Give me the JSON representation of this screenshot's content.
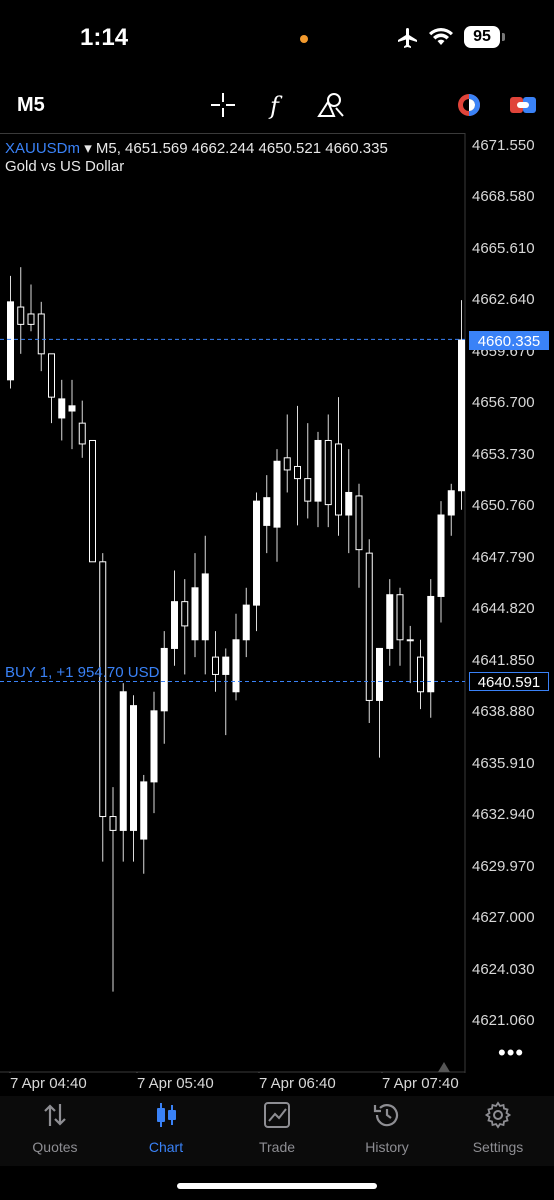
{
  "status": {
    "time": "1:14",
    "battery": "95"
  },
  "toolbar": {
    "timeframe": "M5"
  },
  "chart": {
    "symbol": "XAUUSDm",
    "header": "▾ M5, 4651.569 4662.244 4650.521 4660.335",
    "description": "Gold vs US Dollar",
    "current_price_tag": "4660.335",
    "buy_price_tag": "4640.591",
    "buy_line_label": "BUY 1, +1 954.70 USD",
    "price_labels": [
      "4671.550",
      "4668.580",
      "4665.610",
      "4662.640",
      "4659.670",
      "4656.700",
      "4653.730",
      "4650.760",
      "4647.790",
      "4644.820",
      "4641.850",
      "4638.880",
      "4635.910",
      "4632.940",
      "4629.970",
      "4627.000",
      "4624.030",
      "4621.060"
    ],
    "time_labels": [
      "7 Apr 04:40",
      "7 Apr 05:40",
      "7 Apr 06:40",
      "7 Apr 07:40"
    ],
    "more_label": "•••"
  },
  "chart_data": {
    "type": "candlestick",
    "symbol": "XAUUSDm",
    "timeframe": "M5",
    "ylim": [
      4619.6,
      4673.0
    ],
    "candles": [
      {
        "o": 4658.0,
        "h": 4664.0,
        "l": 4657.5,
        "c": 4662.5
      },
      {
        "o": 4662.2,
        "h": 4664.5,
        "l": 4659.5,
        "c": 4661.2
      },
      {
        "o": 4661.8,
        "h": 4663.5,
        "l": 4660.8,
        "c": 4661.2
      },
      {
        "o": 4661.8,
        "h": 4662.5,
        "l": 4658.5,
        "c": 4659.5
      },
      {
        "o": 4659.5,
        "h": 4659.5,
        "l": 4655.5,
        "c": 4657.0
      },
      {
        "o": 4655.8,
        "h": 4658.0,
        "l": 4654.5,
        "c": 4656.9
      },
      {
        "o": 4656.2,
        "h": 4658.0,
        "l": 4654.0,
        "c": 4656.5
      },
      {
        "o": 4655.5,
        "h": 4656.8,
        "l": 4653.5,
        "c": 4654.3
      },
      {
        "o": 4654.5,
        "h": 4654.5,
        "l": 4648.0,
        "c": 4647.5
      },
      {
        "o": 4647.5,
        "h": 4648.0,
        "l": 4630.2,
        "c": 4632.8
      },
      {
        "o": 4632.8,
        "h": 4634.5,
        "l": 4622.7,
        "c": 4632.0
      },
      {
        "o": 4632.0,
        "h": 4640.5,
        "l": 4630.2,
        "c": 4640.0
      },
      {
        "o": 4632.0,
        "h": 4639.8,
        "l": 4630.2,
        "c": 4639.2
      },
      {
        "o": 4631.5,
        "h": 4635.2,
        "l": 4629.5,
        "c": 4634.8
      },
      {
        "o": 4634.8,
        "h": 4640.0,
        "l": 4633.0,
        "c": 4638.9
      },
      {
        "o": 4638.9,
        "h": 4643.5,
        "l": 4637.0,
        "c": 4642.5
      },
      {
        "o": 4642.5,
        "h": 4647.0,
        "l": 4641.5,
        "c": 4645.2
      },
      {
        "o": 4645.2,
        "h": 4646.5,
        "l": 4641.0,
        "c": 4643.8
      },
      {
        "o": 4643.0,
        "h": 4648.0,
        "l": 4642.0,
        "c": 4646.0
      },
      {
        "o": 4643.0,
        "h": 4649.0,
        "l": 4641.0,
        "c": 4646.8
      },
      {
        "o": 4642.0,
        "h": 4643.5,
        "l": 4640.0,
        "c": 4641.0
      },
      {
        "o": 4641.0,
        "h": 4642.5,
        "l": 4637.5,
        "c": 4642.0
      },
      {
        "o": 4640.0,
        "h": 4644.5,
        "l": 4639.5,
        "c": 4643.0
      },
      {
        "o": 4643.0,
        "h": 4646.0,
        "l": 4642.0,
        "c": 4645.0
      },
      {
        "o": 4645.0,
        "h": 4651.5,
        "l": 4643.5,
        "c": 4651.0
      },
      {
        "o": 4649.6,
        "h": 4652.5,
        "l": 4648.0,
        "c": 4651.2
      },
      {
        "o": 4649.5,
        "h": 4654.0,
        "l": 4647.5,
        "c": 4653.3
      },
      {
        "o": 4653.5,
        "h": 4656.0,
        "l": 4651.5,
        "c": 4652.8
      },
      {
        "o": 4653.0,
        "h": 4656.5,
        "l": 4649.6,
        "c": 4652.3
      },
      {
        "o": 4652.3,
        "h": 4655.5,
        "l": 4650.0,
        "c": 4651.0
      },
      {
        "o": 4651.0,
        "h": 4655.0,
        "l": 4649.5,
        "c": 4654.5
      },
      {
        "o": 4654.5,
        "h": 4656.0,
        "l": 4649.5,
        "c": 4650.8
      },
      {
        "o": 4654.3,
        "h": 4657.0,
        "l": 4649.0,
        "c": 4650.2
      },
      {
        "o": 4650.2,
        "h": 4654.0,
        "l": 4648.0,
        "c": 4651.5
      },
      {
        "o": 4651.3,
        "h": 4652.0,
        "l": 4646.0,
        "c": 4648.2
      },
      {
        "o": 4648.0,
        "h": 4648.8,
        "l": 4638.2,
        "c": 4639.5
      },
      {
        "o": 4639.5,
        "h": 4641.0,
        "l": 4636.2,
        "c": 4642.5
      },
      {
        "o": 4642.5,
        "h": 4646.5,
        "l": 4641.5,
        "c": 4645.6
      },
      {
        "o": 4645.6,
        "h": 4646.0,
        "l": 4641.5,
        "c": 4643.0
      },
      {
        "o": 4643.0,
        "h": 4643.8,
        "l": 4640.5,
        "c": 4643.0
      },
      {
        "o": 4642.0,
        "h": 4643.0,
        "l": 4639.0,
        "c": 4640.0
      },
      {
        "o": 4640.0,
        "h": 4646.5,
        "l": 4638.5,
        "c": 4645.5
      },
      {
        "o": 4645.5,
        "h": 4651.0,
        "l": 4644.0,
        "c": 4650.2
      },
      {
        "o": 4650.2,
        "h": 4652.0,
        "l": 4649.0,
        "c": 4651.6
      },
      {
        "o": 4651.6,
        "h": 4662.6,
        "l": 4650.5,
        "c": 4660.3
      }
    ],
    "horizontal_lines": [
      {
        "label": "current",
        "value": 4660.335
      },
      {
        "label": "BUY 1, +1 954.70 USD",
        "value": 4640.591
      }
    ]
  },
  "tabs": [
    {
      "label": "Quotes"
    },
    {
      "label": "Chart"
    },
    {
      "label": "Trade"
    },
    {
      "label": "History"
    },
    {
      "label": "Settings"
    }
  ]
}
